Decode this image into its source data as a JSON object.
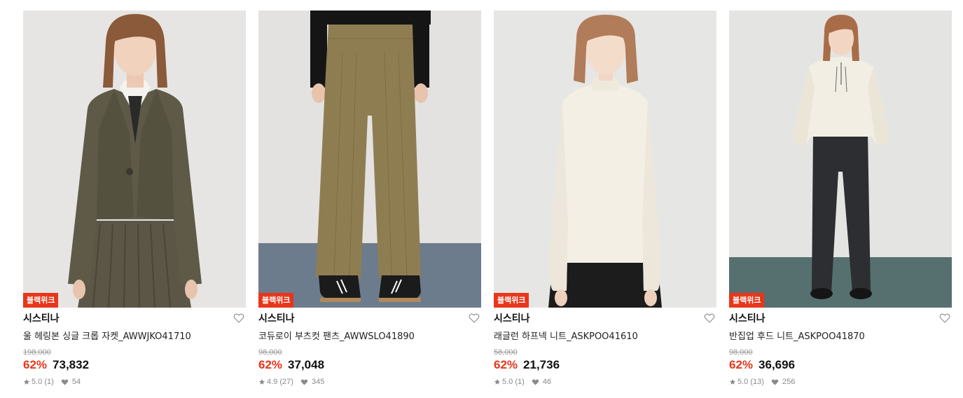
{
  "products": [
    {
      "badge": "블랙위크",
      "brand": "시스티나",
      "name": "울 헤링본 싱글 크롭 자켓_AWWJKO41710",
      "original_price": "198,000",
      "discount": "62%",
      "price": "73,832",
      "rating": "5.0",
      "reviews": "(1)",
      "likes": "54",
      "icons": {
        "rating": "star-icon",
        "likes": "heart-filled-icon",
        "wish": "heart-outline-icon"
      }
    },
    {
      "badge": "블랙위크",
      "brand": "시스티나",
      "name": "코듀로이 부츠컷 팬츠_AWWSLO41890",
      "original_price": "98,000",
      "discount": "62%",
      "price": "37,048",
      "rating": "4.9",
      "reviews": "(27)",
      "likes": "345",
      "icons": {
        "rating": "star-icon",
        "likes": "heart-filled-icon",
        "wish": "heart-outline-icon"
      }
    },
    {
      "badge": "블랙위크",
      "brand": "시스티나",
      "name": "래글런 하프넥 니트_ASKPOO41610",
      "original_price": "58,000",
      "discount": "62%",
      "price": "21,736",
      "rating": "5.0",
      "reviews": "(1)",
      "likes": "46",
      "icons": {
        "rating": "star-icon",
        "likes": "heart-filled-icon",
        "wish": "heart-outline-icon"
      }
    },
    {
      "badge": "블랙위크",
      "brand": "시스티나",
      "name": "반집업 후드 니트_ASKPOO41870",
      "original_price": "98,000",
      "discount": "62%",
      "price": "36,696",
      "rating": "5.0",
      "reviews": "(13)",
      "likes": "256",
      "icons": {
        "rating": "star-icon",
        "likes": "heart-filled-icon",
        "wish": "heart-outline-icon"
      }
    }
  ],
  "colors": {
    "accent": "#e8361b",
    "muted": "#8a8a8a"
  }
}
